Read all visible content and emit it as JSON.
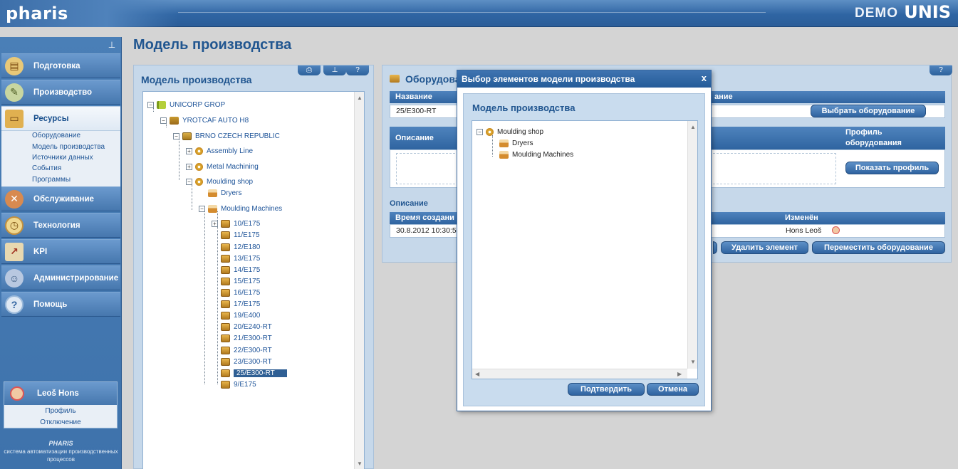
{
  "header": {
    "logo": "pharis",
    "demo": "DEMO",
    "brand": "UNIS"
  },
  "nav": {
    "items": [
      {
        "label": "Подготовка",
        "icon": "book-icon"
      },
      {
        "label": "Производство",
        "icon": "tools-icon"
      },
      {
        "label": "Ресурсы",
        "icon": "resources-icon"
      },
      {
        "label": "Обслуживание",
        "icon": "maintenance-icon"
      },
      {
        "label": "Технология",
        "icon": "clock-icon"
      },
      {
        "label": "KPI",
        "icon": "chart-icon"
      },
      {
        "label": "Администрирование",
        "icon": "users-icon"
      },
      {
        "label": "Помощь",
        "icon": "help-icon"
      }
    ],
    "sub_items": [
      "Оборудование",
      "Модель производства",
      "Источники данных",
      "События",
      "Программы"
    ],
    "user": {
      "name": "Leoš  Hons",
      "profile": "Профиль",
      "logout": "Отключение"
    },
    "footer": {
      "logo": "PHARIS",
      "text1": "система автоматизации производственных",
      "text2": "процессов"
    }
  },
  "page_title": "Модель производства",
  "left_panel": {
    "title": "Модель производства",
    "tree": [
      {
        "label": "UNICORP GROP",
        "icon": "ic-flag"
      },
      {
        "label": "YROTCAF AUTO H8",
        "icon": "ic-factory"
      },
      {
        "label": "BRNO CZECH REPUBLIC",
        "icon": "ic-site"
      },
      {
        "label": "Assembly Line",
        "icon": "ic-gear"
      },
      {
        "label": "Metal Machining",
        "icon": "ic-gear"
      },
      {
        "label": "Moulding shop",
        "icon": "ic-gear"
      },
      {
        "label": "Dryers",
        "icon": "ic-machine"
      },
      {
        "label": "Moulding Machines",
        "icon": "ic-machine"
      },
      {
        "label": "10/E175",
        "icon": "ic-eq"
      },
      {
        "label": "11/E175",
        "icon": "ic-eq"
      },
      {
        "label": "12/E180",
        "icon": "ic-eq"
      },
      {
        "label": "13/E175",
        "icon": "ic-eq"
      },
      {
        "label": "14/E175",
        "icon": "ic-eq"
      },
      {
        "label": "15/E175",
        "icon": "ic-eq"
      },
      {
        "label": "16/E175",
        "icon": "ic-eq"
      },
      {
        "label": "17/E175",
        "icon": "ic-eq"
      },
      {
        "label": "19/E400",
        "icon": "ic-eq"
      },
      {
        "label": "20/E240-RT",
        "icon": "ic-eq"
      },
      {
        "label": "21/E300-RT",
        "icon": "ic-eq"
      },
      {
        "label": "22/E300-RT",
        "icon": "ic-eq"
      },
      {
        "label": "23/E300-RT",
        "icon": "ic-eq"
      },
      {
        "label": "25/E300-RT",
        "icon": "ic-eq"
      },
      {
        "label": "9/E175",
        "icon": "ic-eq"
      }
    ]
  },
  "right_panel": {
    "title": "Оборудование",
    "name_header": "Название",
    "name_value": "25/E300-RT",
    "equipment_header": "ание",
    "select_equipment": "Выбрать оборудование",
    "description_header": "Описание",
    "profile_header_1": "Профиль",
    "profile_header_2": "оборудования",
    "show_profile": "Показать профиль",
    "description_label": "Описание",
    "created_header": "Время создани",
    "created_value": "30.8.2012 10:30:5",
    "changed_header": "Изменён",
    "changed_value": "Hons Leoš",
    "delete_button": "Удалить элемент",
    "move_button": "Переместить оборудование"
  },
  "dialog": {
    "title": "Выбор элементов модели производства",
    "close": "x",
    "section_title": "Модель производства",
    "tree": [
      {
        "label": "Moulding shop",
        "icon": "ic-gear"
      },
      {
        "label": "Dryers",
        "icon": "ic-machine"
      },
      {
        "label": "Moulding Machines",
        "icon": "ic-machine"
      }
    ],
    "confirm": "Подтвердить",
    "cancel": "Отмена"
  }
}
